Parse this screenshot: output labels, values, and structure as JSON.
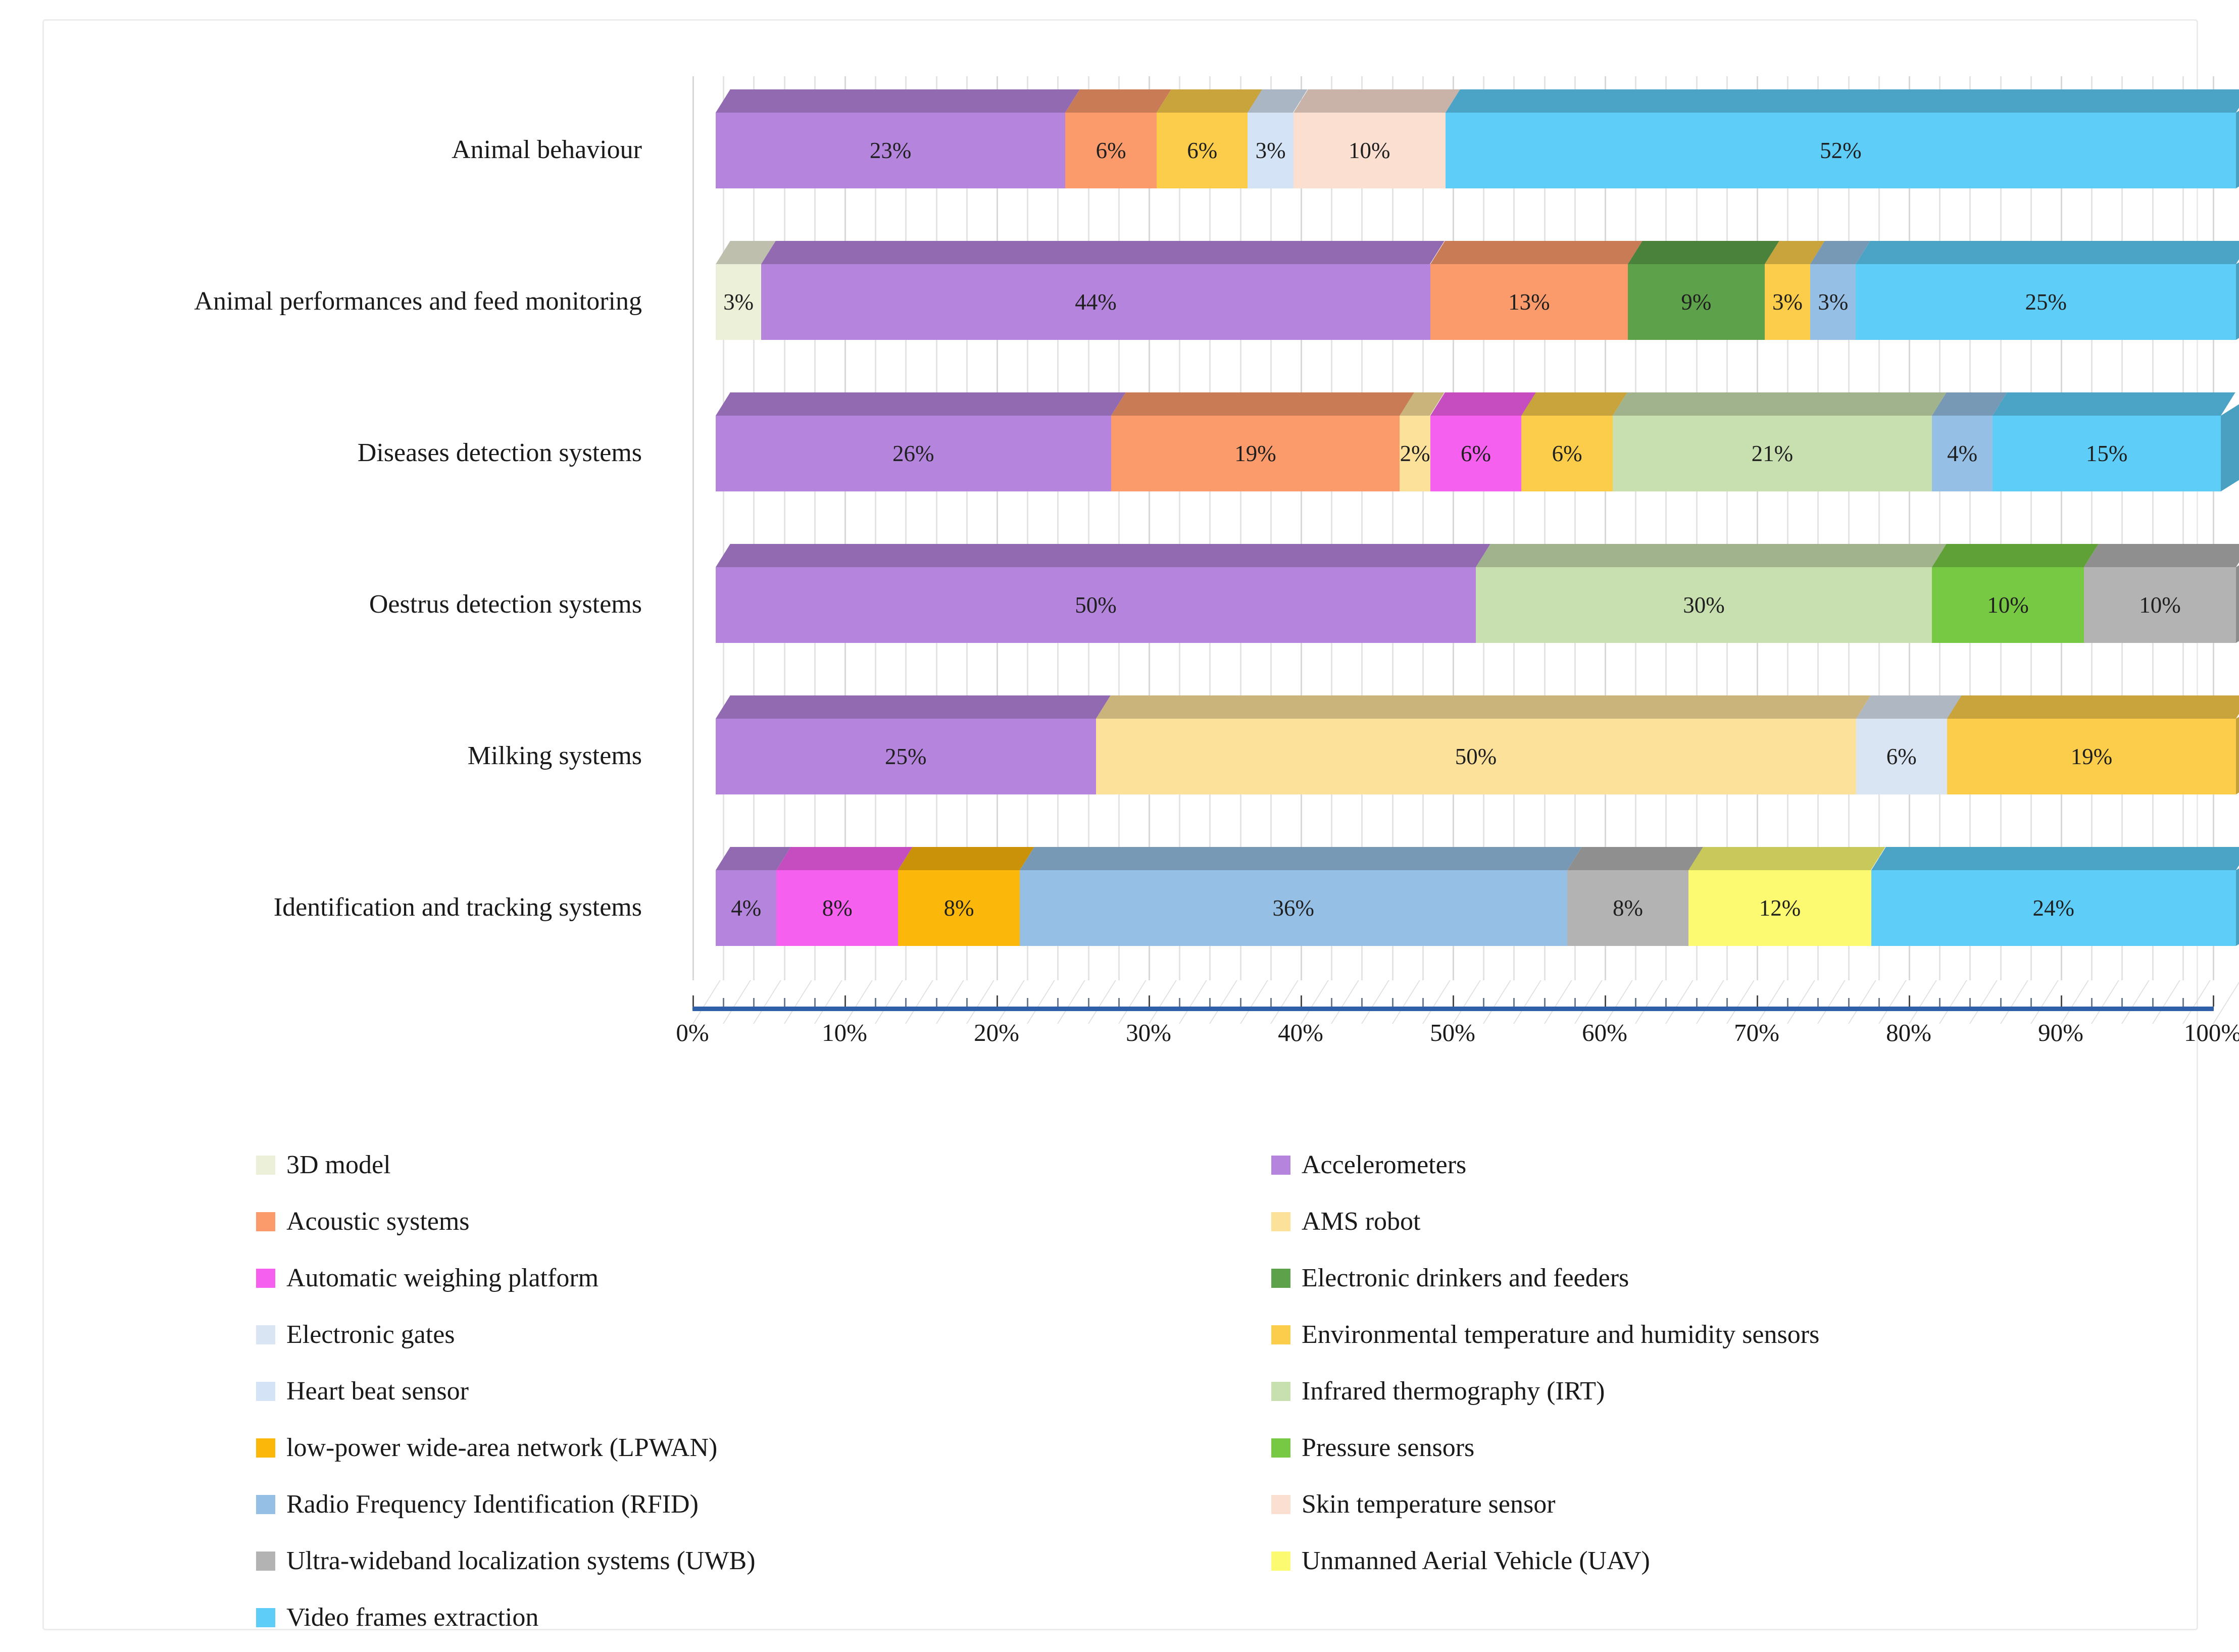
{
  "chart_data": {
    "type": "bar",
    "orientation": "horizontal",
    "stacked": true,
    "percent_stacked": true,
    "three_d": true,
    "title": "",
    "xlabel": "",
    "ylabel": "",
    "xlim": [
      0,
      100
    ],
    "xticks": [
      "0%",
      "10%",
      "20%",
      "30%",
      "40%",
      "50%",
      "60%",
      "70%",
      "80%",
      "90%",
      "100%"
    ],
    "grid": true,
    "legend_position": "bottom",
    "categories": [
      "Animal behaviour",
      "Animal performances and feed monitoring",
      "Diseases detection systems",
      "Oestrus detection systems",
      "Milking systems",
      "Identification and tracking systems"
    ],
    "series": [
      {
        "name": "3D model",
        "color": "#edf0d8",
        "values": [
          0,
          3,
          0,
          0,
          0,
          0
        ]
      },
      {
        "name": "Accelerometers",
        "color": "#b585dd",
        "values": [
          23,
          44,
          26,
          50,
          25,
          4
        ]
      },
      {
        "name": "Acoustic systems",
        "color": "#fb9a6a",
        "values": [
          6,
          13,
          19,
          0,
          0,
          0
        ]
      },
      {
        "name": "AMS robot",
        "color": "#fce19a",
        "values": [
          0,
          0,
          2,
          0,
          50,
          0
        ]
      },
      {
        "name": "Automatic weighing platform",
        "color": "#f660ef",
        "values": [
          0,
          0,
          6,
          0,
          0,
          8
        ]
      },
      {
        "name": "Electronic drinkers and feeders",
        "color": "#5da24a",
        "values": [
          0,
          9,
          0,
          0,
          0,
          0
        ]
      },
      {
        "name": "Electronic gates",
        "color": "#d9e5f3",
        "values": [
          0,
          0,
          0,
          0,
          6,
          0
        ]
      },
      {
        "name": "Environmental temperature and humidity sensors",
        "color": "#fbcd4b",
        "values": [
          6,
          3,
          6,
          0,
          19,
          0
        ]
      },
      {
        "name": "Heart beat sensor",
        "color": "#d4e3f5",
        "values": [
          3,
          0,
          0,
          0,
          0,
          0
        ]
      },
      {
        "name": "Infrared thermography (IRT)",
        "color": "#c8e0b0",
        "values": [
          0,
          0,
          21,
          30,
          0,
          0
        ]
      },
      {
        "name": "low-power wide-area network (LPWAN)",
        "color": "#fcb70b",
        "values": [
          0,
          0,
          0,
          0,
          0,
          8
        ]
      },
      {
        "name": "Pressure sensors",
        "color": "#77c943",
        "values": [
          0,
          0,
          0,
          10,
          0,
          0
        ]
      },
      {
        "name": "Radio Frequency Identification (RFID)",
        "color": "#95bfe4",
        "values": [
          0,
          3,
          4,
          0,
          0,
          36
        ]
      },
      {
        "name": "Skin temperature sensor",
        "color": "#fbe0d2",
        "values": [
          10,
          0,
          0,
          0,
          0,
          0
        ]
      },
      {
        "name": "Ultra-wideband localization systems (UWB)",
        "color": "#b3b3b3",
        "values": [
          0,
          0,
          0,
          10,
          0,
          8
        ]
      },
      {
        "name": "Unmanned Aerial Vehicle (UAV)",
        "color": "#fbfa70",
        "values": [
          0,
          0,
          0,
          0,
          0,
          12
        ]
      },
      {
        "name": "Video frames extraction",
        "color": "#5ecdf7",
        "values": [
          52,
          25,
          15,
          0,
          0,
          24
        ]
      }
    ],
    "rows": [
      {
        "category": "Animal behaviour",
        "segments": [
          {
            "series": "Accelerometers",
            "value": 23,
            "label": "23%",
            "color": "#b585dd"
          },
          {
            "series": "Acoustic systems",
            "value": 6,
            "label": "6%",
            "color": "#fb9a6a"
          },
          {
            "series": "Environmental temperature and humidity sensors",
            "value": 6,
            "label": "6%",
            "color": "#fbcd4b"
          },
          {
            "series": "Heart beat sensor",
            "value": 3,
            "label": "3%",
            "color": "#d4e3f5"
          },
          {
            "series": "Skin temperature sensor",
            "value": 10,
            "label": "10%",
            "color": "#fbe0d2"
          },
          {
            "series": "Video frames extraction",
            "value": 52,
            "label": "52%",
            "color": "#5ecdf7"
          }
        ]
      },
      {
        "category": "Animal performances and feed monitoring",
        "segments": [
          {
            "series": "3D model",
            "value": 3,
            "label": "3%",
            "color": "#edf0d8"
          },
          {
            "series": "Accelerometers",
            "value": 44,
            "label": "44%",
            "color": "#b585dd"
          },
          {
            "series": "Acoustic systems",
            "value": 13,
            "label": "13%",
            "color": "#fb9a6a"
          },
          {
            "series": "Electronic drinkers and feeders",
            "value": 9,
            "label": "9%",
            "color": "#5da24a"
          },
          {
            "series": "Environmental temperature and humidity sensors",
            "value": 3,
            "label": "3%",
            "color": "#fbcd4b"
          },
          {
            "series": "Radio Frequency Identification (RFID)",
            "value": 3,
            "label": "3%",
            "color": "#95bfe4"
          },
          {
            "series": "Video frames extraction",
            "value": 25,
            "label": "25%",
            "color": "#5ecdf7"
          }
        ]
      },
      {
        "category": "Diseases detection systems",
        "segments": [
          {
            "series": "Accelerometers",
            "value": 26,
            "label": "26%",
            "color": "#b585dd"
          },
          {
            "series": "Acoustic systems",
            "value": 19,
            "label": "19%",
            "color": "#fb9a6a"
          },
          {
            "series": "AMS robot",
            "value": 2,
            "label": "2%",
            "color": "#fce19a"
          },
          {
            "series": "Automatic weighing platform",
            "value": 6,
            "label": "6%",
            "color": "#f660ef"
          },
          {
            "series": "Environmental temperature and humidity sensors",
            "value": 6,
            "label": "6%",
            "color": "#fbcd4b"
          },
          {
            "series": "Infrared thermography (IRT)",
            "value": 21,
            "label": "21%",
            "color": "#c8e0b0"
          },
          {
            "series": "Radio Frequency Identification (RFID)",
            "value": 4,
            "label": "4%",
            "color": "#95bfe4"
          },
          {
            "series": "Video frames extraction",
            "value": 15,
            "label": "15%",
            "color": "#5ecdf7"
          }
        ]
      },
      {
        "category": "Oestrus detection systems",
        "segments": [
          {
            "series": "Accelerometers",
            "value": 50,
            "label": "50%",
            "color": "#b585dd"
          },
          {
            "series": "Infrared thermography (IRT)",
            "value": 30,
            "label": "30%",
            "color": "#c8e0b0"
          },
          {
            "series": "Pressure sensors",
            "value": 10,
            "label": "10%",
            "color": "#77c943"
          },
          {
            "series": "Ultra-wideband localization systems (UWB)",
            "value": 10,
            "label": "10%",
            "color": "#b3b3b3"
          }
        ]
      },
      {
        "category": "Milking systems",
        "segments": [
          {
            "series": "Accelerometers",
            "value": 25,
            "label": "25%",
            "color": "#b585dd"
          },
          {
            "series": "AMS robot",
            "value": 50,
            "label": "50%",
            "color": "#fce19a"
          },
          {
            "series": "Electronic gates",
            "value": 6,
            "label": "6%",
            "color": "#d9e5f3"
          },
          {
            "series": "Environmental temperature and humidity sensors",
            "value": 19,
            "label": "19%",
            "color": "#fbcd4b"
          }
        ]
      },
      {
        "category": "Identification and tracking systems",
        "segments": [
          {
            "series": "Accelerometers",
            "value": 4,
            "label": "4%",
            "color": "#b585dd"
          },
          {
            "series": "Automatic weighing platform",
            "value": 8,
            "label": "8%",
            "color": "#f660ef"
          },
          {
            "series": "low-power wide-area network (LPWAN)",
            "value": 8,
            "label": "8%",
            "color": "#fcb70b"
          },
          {
            "series": "Radio Frequency Identification (RFID)",
            "value": 36,
            "label": "36%",
            "color": "#95bfe4"
          },
          {
            "series": "Ultra-wideband localization systems (UWB)",
            "value": 8,
            "label": "8%",
            "color": "#b3b3b3"
          },
          {
            "series": "Unmanned Aerial Vehicle (UAV)",
            "value": 12,
            "label": "12%",
            "color": "#fbfa70"
          },
          {
            "series": "Video frames extraction",
            "value": 24,
            "label": "24%",
            "color": "#5ecdf7"
          }
        ]
      }
    ]
  },
  "legend": {
    "left_column": [
      {
        "label": "3D model",
        "color": "#edf0d8"
      },
      {
        "label": "Acoustic systems",
        "color": "#fb9a6a"
      },
      {
        "label": "Automatic weighing platform",
        "color": "#f660ef"
      },
      {
        "label": "Electronic gates",
        "color": "#d9e5f3"
      },
      {
        "label": "Heart beat sensor",
        "color": "#d4e3f5"
      },
      {
        "label": "low-power wide-area network (LPWAN)",
        "color": "#fcb70b"
      },
      {
        "label": "Radio Frequency Identification (RFID)",
        "color": "#95bfe4"
      },
      {
        "label": "Ultra-wideband localization systems (UWB)",
        "color": "#b3b3b3"
      },
      {
        "label": "Video frames extraction",
        "color": "#5ecdf7"
      }
    ],
    "right_column": [
      {
        "label": "Accelerometers",
        "color": "#b585dd"
      },
      {
        "label": "AMS robot",
        "color": "#fce19a"
      },
      {
        "label": "Electronic drinkers and feeders",
        "color": "#5da24a"
      },
      {
        "label": "Environmental temperature and humidity sensors",
        "color": "#fbcd4b"
      },
      {
        "label": "Infrared thermography (IRT)",
        "color": "#c8e0b0"
      },
      {
        "label": "Pressure sensors",
        "color": "#77c943"
      },
      {
        "label": "Skin temperature sensor",
        "color": "#fbe0d2"
      },
      {
        "label": "Unmanned Aerial Vehicle (UAV)",
        "color": "#fbfa70"
      }
    ]
  },
  "axis": {
    "color": "#2f5fa8"
  }
}
